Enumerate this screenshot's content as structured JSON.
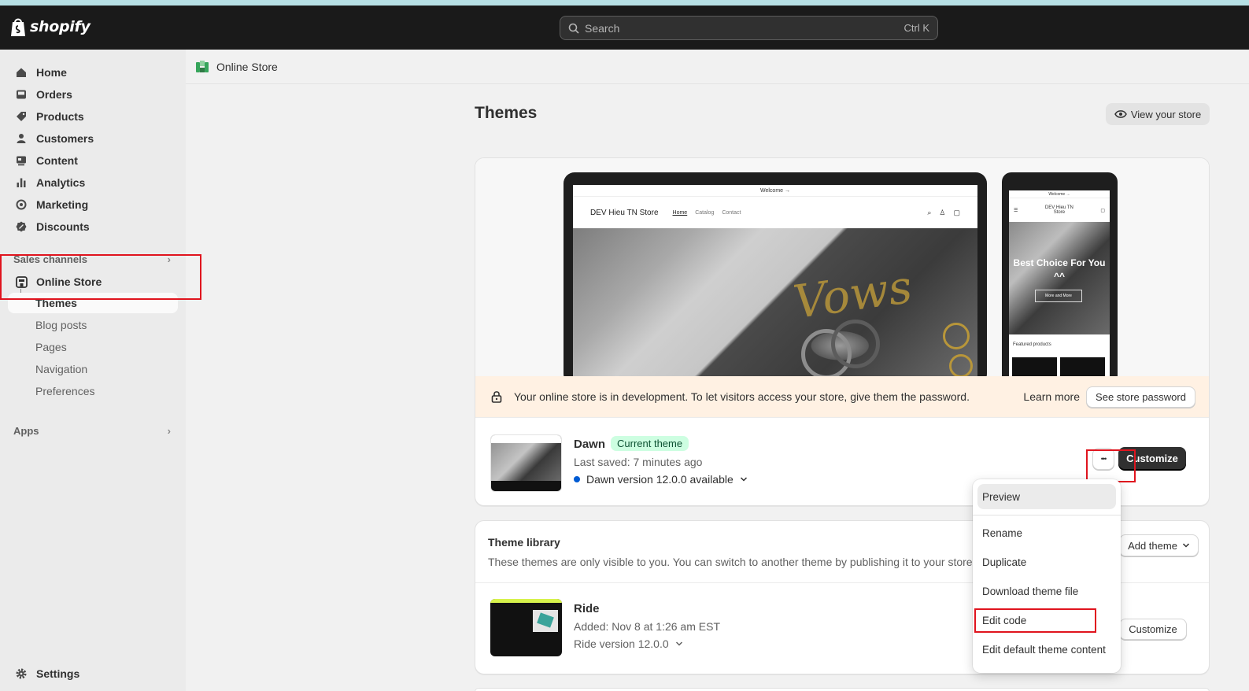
{
  "topbar": {
    "logo_text": "shopify",
    "search_placeholder": "Search",
    "search_shortcut": "Ctrl K"
  },
  "sidebar": {
    "items": [
      {
        "label": "Home",
        "icon": "home-icon"
      },
      {
        "label": "Orders",
        "icon": "inbox-icon"
      },
      {
        "label": "Products",
        "icon": "tag-icon"
      },
      {
        "label": "Customers",
        "icon": "person-icon"
      },
      {
        "label": "Content",
        "icon": "content-icon"
      },
      {
        "label": "Analytics",
        "icon": "bar-chart-icon"
      },
      {
        "label": "Marketing",
        "icon": "target-icon"
      },
      {
        "label": "Discounts",
        "icon": "discount-icon"
      }
    ],
    "sales_channels_label": "Sales channels",
    "online_store_label": "Online Store",
    "sub_items": [
      "Themes",
      "Blog posts",
      "Pages",
      "Navigation",
      "Preferences"
    ],
    "apps_label": "Apps",
    "settings_label": "Settings"
  },
  "breadcrumb": {
    "label": "Online Store"
  },
  "page": {
    "title": "Themes",
    "view_store_label": "View your store"
  },
  "preview": {
    "laptop": {
      "welcome": "Welcome →",
      "store_name": "DEV Hieu TN Store",
      "nav_links": [
        "Home",
        "Catalog",
        "Contact"
      ],
      "hero_text": "Vows"
    },
    "phone": {
      "welcome": "Welcome →",
      "store_name": "DEV Hieu TN Store",
      "hero_title": "Best Choice For You ^^",
      "hero_button": "More and More",
      "featured_label": "Featured products"
    }
  },
  "dev_banner": {
    "message": "Your online store is in development. To let visitors access your store, give them the password.",
    "learn_more": "Learn more",
    "see_password": "See store password",
    "bg_color": "#fff1e3"
  },
  "current_theme": {
    "name": "Dawn",
    "badge": "Current theme",
    "last_saved": "Last saved: 7 minutes ago",
    "version": "Dawn version 12.0.0 available",
    "customize_label": "Customize",
    "more_label": "•••"
  },
  "library": {
    "title": "Theme library",
    "description": "These themes are only visible to you. You can switch to another theme by publishing it to your store.",
    "add_theme_label": "Add theme",
    "themes": [
      {
        "name": "Ride",
        "added": "Added: Nov 8 at 1:26 am EST",
        "version": "Ride version 12.0.0",
        "customize_label": "Customize"
      }
    ]
  },
  "menu": {
    "items": [
      "Preview",
      "Rename",
      "Duplicate",
      "Download theme file",
      "Edit code",
      "Edit default theme content"
    ]
  },
  "colors": {
    "highlight_red": "#e0141e",
    "topbar": "#1a1a1a",
    "badge_green": "#cdfee1",
    "version_dot": "#005bd3"
  }
}
